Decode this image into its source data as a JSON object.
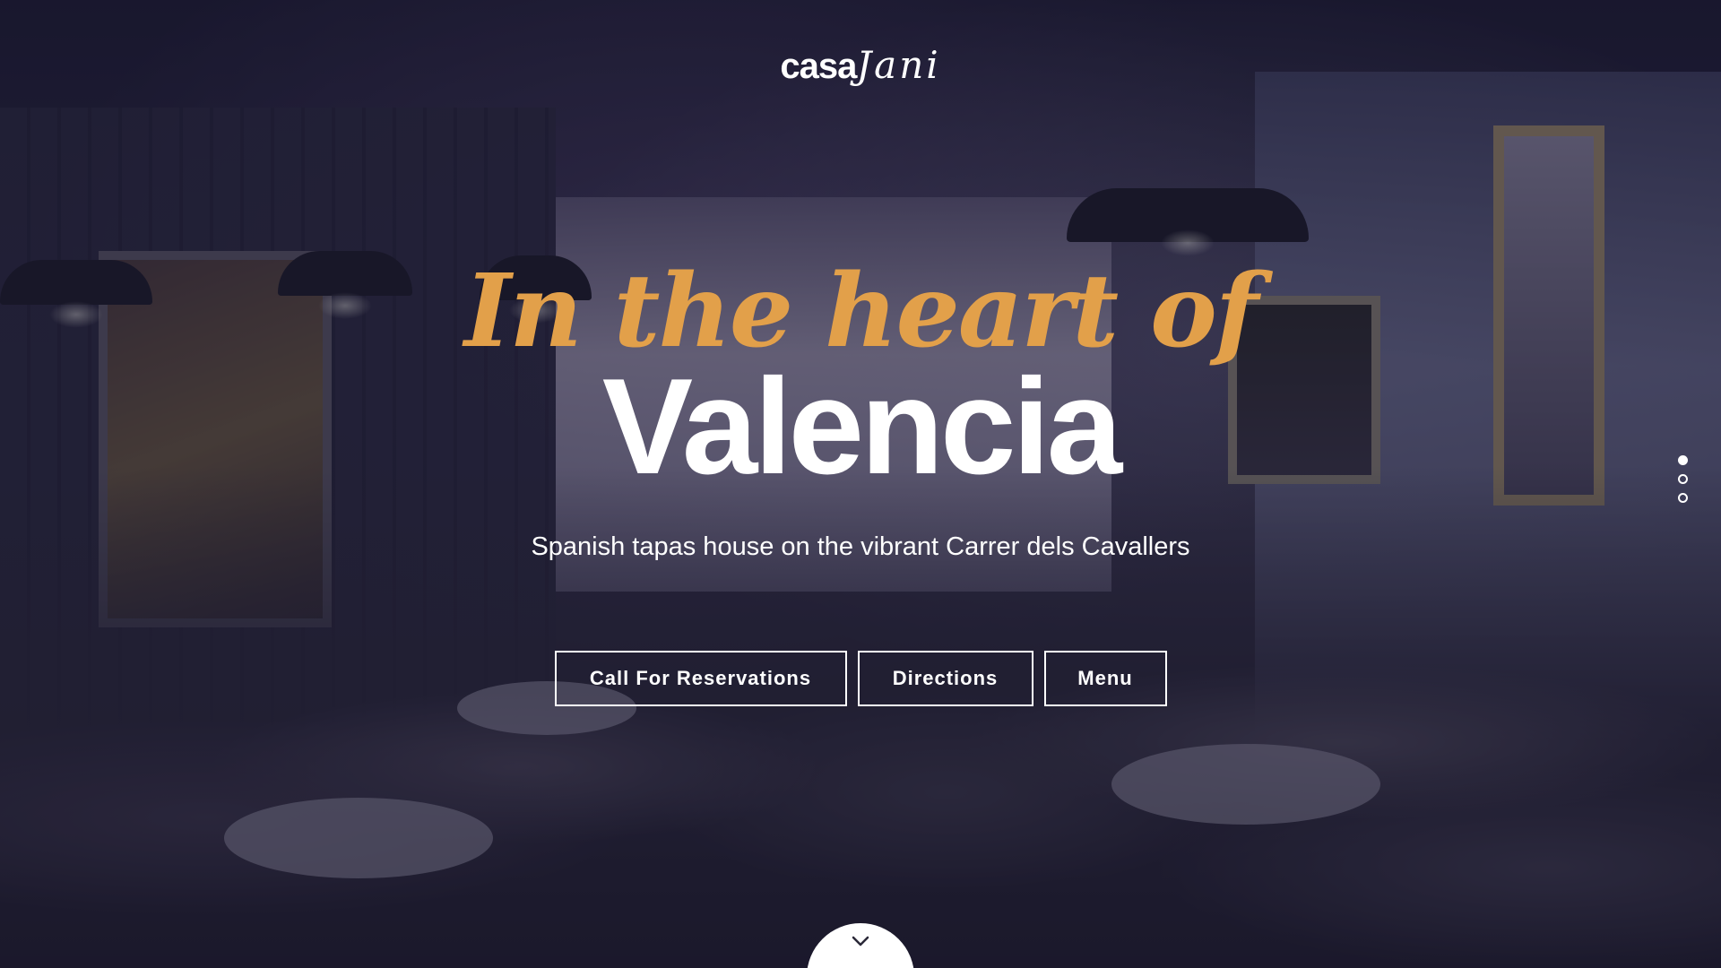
{
  "brand": {
    "logo_part1": "casa",
    "logo_part2": "Jani"
  },
  "hero": {
    "script_line": "In the heart of",
    "headline": "Valencia",
    "subtitle": "Spanish tapas house on the vibrant Carrer dels Cavallers",
    "accent_color": "#e2a04a"
  },
  "actions": {
    "reservations_label": "Call For Reservations",
    "directions_label": "Directions",
    "menu_label": "Menu"
  },
  "slider": {
    "total_slides": 3,
    "active_slide": 1
  },
  "icons": {
    "scroll": "chevron-down-icon"
  }
}
